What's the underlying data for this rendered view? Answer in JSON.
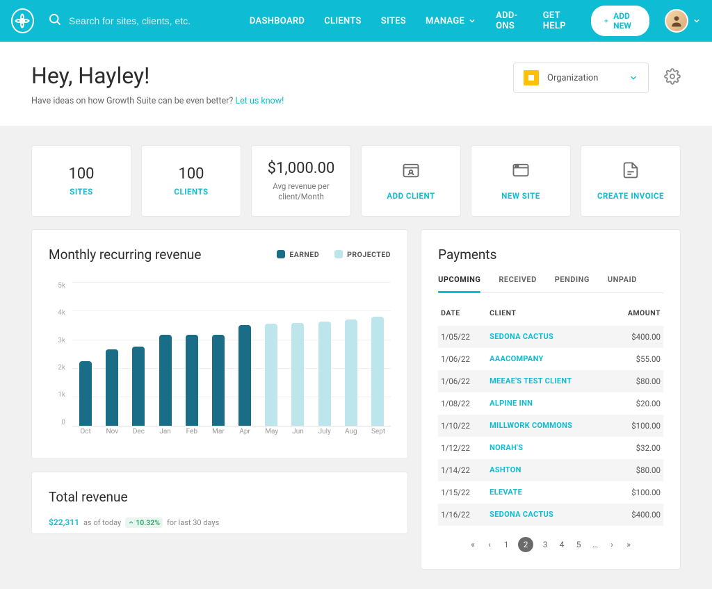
{
  "nav": {
    "search_placeholder": "Search for sites, clients, etc.",
    "links": [
      "DASHBOARD",
      "CLIENTS",
      "SITES",
      "MANAGE",
      "ADD-ONS",
      "GET HELP"
    ],
    "add_new": "ADD NEW"
  },
  "header": {
    "greeting": "Hey, Hayley!",
    "subtitle_prefix": "Have ideas on how Growth Suite can be even better? ",
    "subtitle_link": "Let us know!",
    "org_label": "Organization"
  },
  "stats": {
    "sites_value": "100",
    "sites_label": "SITES",
    "clients_value": "100",
    "clients_label": "CLIENTS",
    "avg_value": "$1,000.00",
    "avg_label": "Avg revenue per client/Month",
    "add_client": "ADD CLIENT",
    "new_site": "NEW SITE",
    "create_invoice": "CREATE INVOICE"
  },
  "chart_data": {
    "type": "bar",
    "title": "Monthly recurring revenue",
    "ylabel": "",
    "xlabel": "",
    "ylim": [
      0,
      5000
    ],
    "y_ticks": [
      "5k",
      "4k",
      "3k",
      "2k",
      "1k",
      "0"
    ],
    "categories": [
      "Oct",
      "Nov",
      "Dec",
      "Jan",
      "Feb",
      "Mar",
      "Apr",
      "May",
      "Jun",
      "July",
      "Aug",
      "Sept"
    ],
    "series": [
      {
        "name": "EARNED",
        "color": "#1a6d86",
        "values": [
          2250,
          2650,
          2750,
          3150,
          3150,
          3150,
          3500,
          null,
          null,
          null,
          null,
          null
        ]
      },
      {
        "name": "PROJECTED",
        "color": "#bce5ec",
        "values": [
          null,
          null,
          null,
          null,
          null,
          null,
          null,
          3550,
          3580,
          3620,
          3700,
          3780
        ]
      }
    ],
    "legend": [
      {
        "label": "EARNED",
        "color": "#1a6d86"
      },
      {
        "label": "PROJECTED",
        "color": "#bce5ec"
      }
    ]
  },
  "total_revenue": {
    "title": "Total revenue",
    "amount": "$22,311",
    "as_of": "as of today",
    "change": "10.32%",
    "period": "for last 30 days"
  },
  "payments": {
    "title": "Payments",
    "tabs": [
      "UPCOMING",
      "RECEIVED",
      "PENDING",
      "UNPAID"
    ],
    "active_tab": 0,
    "columns": {
      "date": "DATE",
      "client": "CLIENT",
      "amount": "AMOUNT"
    },
    "rows": [
      {
        "date": "1/05/22",
        "client": "SEDONA CACTUS",
        "amount": "$400.00"
      },
      {
        "date": "1/06/22",
        "client": "AAACOMPANY",
        "amount": "$55.00"
      },
      {
        "date": "1/06/22",
        "client": "MEEAE'S TEST CLIENT",
        "amount": "$80.00"
      },
      {
        "date": "1/08/22",
        "client": "ALPINE INN",
        "amount": "$20.00"
      },
      {
        "date": "1/10/22",
        "client": "MILLWORK COMMONS",
        "amount": "$100.00"
      },
      {
        "date": "1/12/22",
        "client": "NORAH'S",
        "amount": "$32.00"
      },
      {
        "date": "1/14/22",
        "client": "ASHTON",
        "amount": "$80.00"
      },
      {
        "date": "1/15/22",
        "client": "ELEVATE",
        "amount": "$100.00"
      },
      {
        "date": "1/16/22",
        "client": "SEDONA CACTUS",
        "amount": "$400.00"
      }
    ],
    "pages": [
      "1",
      "2",
      "3",
      "4",
      "5",
      "…"
    ],
    "current_page": "2"
  }
}
